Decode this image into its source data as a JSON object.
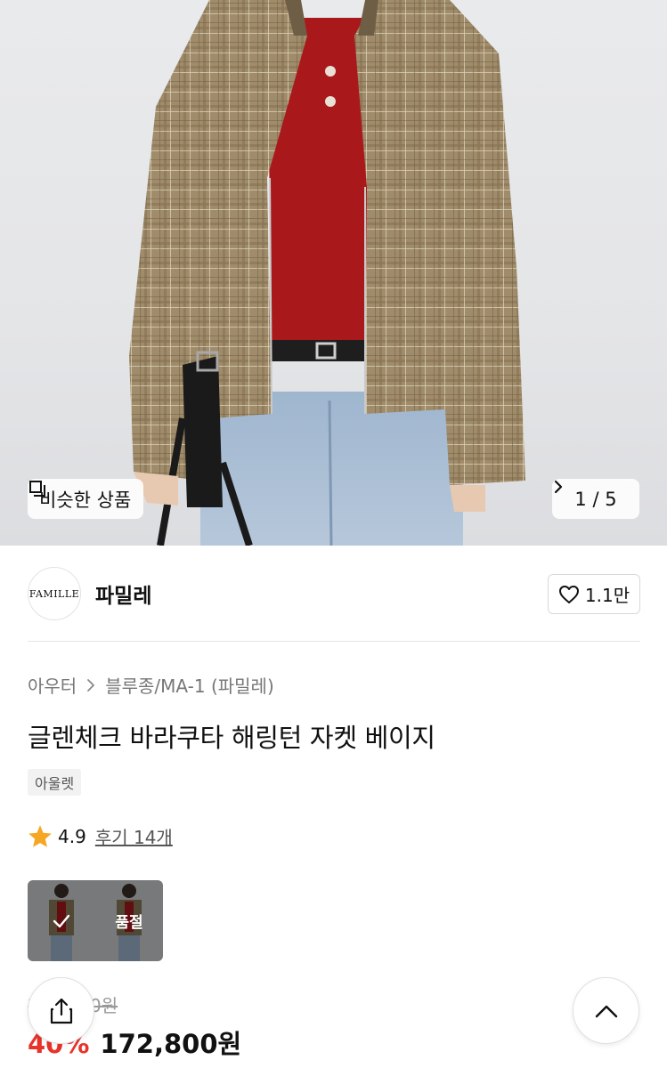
{
  "hero": {
    "similar_label": "비슷한 상품",
    "pager_text": "1 / 5"
  },
  "brand": {
    "logo_text": "FAMILLE",
    "name": "파밀레",
    "like_count": "1.1만"
  },
  "product": {
    "breadcrumb": [
      "아우터",
      "블루종/MA-1 (파밀레)"
    ],
    "title": "글렌체크 바라쿠타 해링턴 자켓 베이지",
    "tag": "아울렛",
    "rating": "4.9",
    "reviews": "후기 14개",
    "thumb_soldout_label": "품절",
    "original_price": "288,000원",
    "discount": "40%",
    "price": "172,800원"
  },
  "colors": {
    "accent_red": "#e8332a",
    "star": "#f5a623"
  },
  "icons": {
    "similar": "copy-icon",
    "pager_next": "chevron-right-icon",
    "like": "heart-icon",
    "breadcrumb_sep": "chevron-right-icon",
    "rating": "star-icon",
    "thumb_selected": "check-icon",
    "share": "share-icon",
    "scroll_top": "chevron-up-icon"
  }
}
